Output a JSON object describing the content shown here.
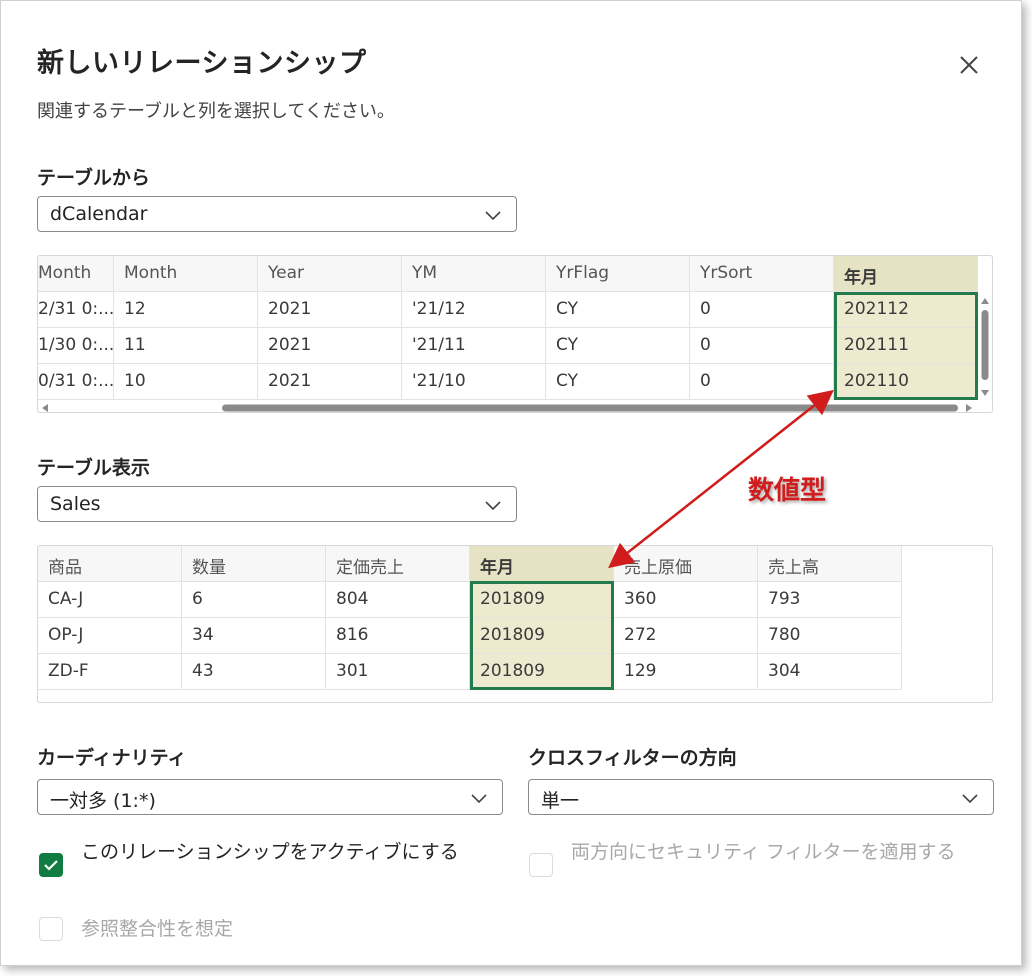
{
  "dialog": {
    "title": "新しいリレーションシップ",
    "subtitle": "関連するテーブルと列を選択してください。",
    "close_icon": "close-icon"
  },
  "from_table": {
    "label": "テーブルから",
    "selected": "dCalendar",
    "columns": [
      "Month",
      "Month",
      "Year",
      "YM",
      "YrFlag",
      "YrSort",
      "年月"
    ],
    "rows": [
      [
        "2/31 0:...",
        "12",
        "2021",
        "'21/12",
        "CY",
        "0",
        "202112"
      ],
      [
        "1/30 0:...",
        "11",
        "2021",
        "'21/11",
        "CY",
        "0",
        "202111"
      ],
      [
        "0/31 0:...",
        "10",
        "2021",
        "'21/10",
        "CY",
        "0",
        "202110"
      ]
    ],
    "selected_column": "年月"
  },
  "to_table": {
    "label": "テーブル表示",
    "selected": "Sales",
    "columns": [
      "商品",
      "数量",
      "定価売上",
      "年月",
      "売上原価",
      "売上高"
    ],
    "rows": [
      [
        "CA-J",
        "6",
        "804",
        "201809",
        "360",
        "793"
      ],
      [
        "OP-J",
        "34",
        "816",
        "201809",
        "272",
        "780"
      ],
      [
        "ZD-F",
        "43",
        "301",
        "201809",
        "129",
        "304"
      ]
    ],
    "selected_column": "年月"
  },
  "cardinality": {
    "label": "カーディナリティ",
    "selected": "一対多 (1:*)"
  },
  "cross_filter": {
    "label": "クロスフィルターの方向",
    "selected": "単一"
  },
  "options": {
    "active_label": "このリレーションシップをアクティブにする",
    "active_checked": true,
    "security_label": "両方向にセキュリティ フィルターを適用する",
    "security_checked": false,
    "integrity_label": "参照整合性を想定",
    "integrity_checked": false
  },
  "annotation": {
    "text": "数値型",
    "color": "#d01c1c"
  },
  "colors": {
    "accent": "#107c41",
    "highlight": "#eeead0",
    "highlight_border": "#237b4b"
  }
}
